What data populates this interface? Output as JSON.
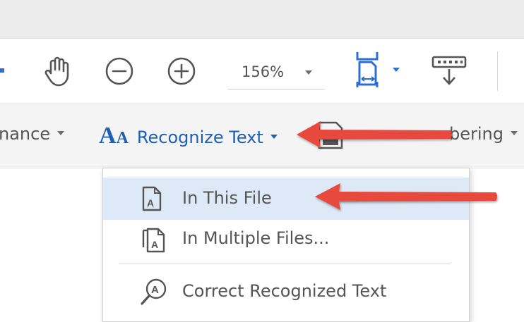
{
  "toolbar": {
    "hand_icon": "hand-icon",
    "zoom_out_icon": "zoom-out-icon",
    "zoom_in_icon": "zoom-in-icon",
    "zoom_value": "156%",
    "page_display_icon": "page-display-icon",
    "read_mode_icon": "read-mode-icon"
  },
  "subtoolbar": {
    "enhance_label": "nance",
    "recognize_label": "Recognize Text",
    "recognize_icon": "aa-text-icon",
    "bates_label": "bering"
  },
  "menu": {
    "items": [
      {
        "label": "In This File",
        "icon": "single-file-text-icon",
        "highlighted": true
      },
      {
        "label": "In Multiple Files...",
        "icon": "multiple-files-text-icon",
        "highlighted": false
      },
      {
        "label": "Correct Recognized Text",
        "icon": "correct-text-magnifier-icon",
        "highlighted": false
      }
    ]
  },
  "annotations": {
    "arrow_color": "#e8483c"
  },
  "colors": {
    "accent_blue": "#1f5fb4",
    "menu_highlight": "#dde9f6",
    "subbar_bg": "#f4f4f4"
  }
}
